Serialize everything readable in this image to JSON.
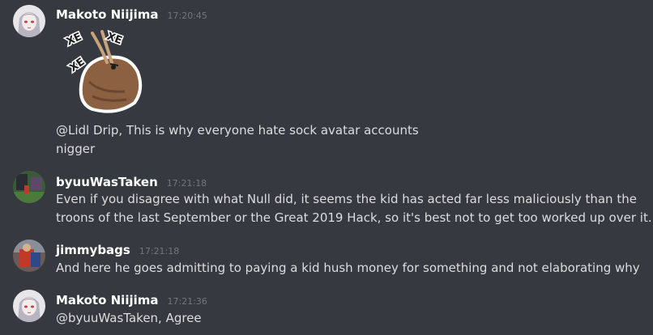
{
  "messages": [
    {
      "username": "Makoto Niijima",
      "timestamp": "17:20:45",
      "sticker": {
        "text_1": "XE",
        "text_2": "XE",
        "text_3": "XE"
      },
      "lines": [
        "@Lidl Drip, This is why everyone hate sock avatar accounts",
        "nigger"
      ]
    },
    {
      "username": "byuuWasTaken",
      "timestamp": "17:21:18",
      "lines": [
        "Even if you disagree with what Null did, it seems the kid has acted far less maliciously than the",
        "troons of the last September or the Great 2019 Hack, so it's best not to get too worked up over it."
      ]
    },
    {
      "username": "jimmybags",
      "timestamp": "17:21:18",
      "lines": [
        "And here he goes admitting to paying a kid hush money for something and not elaborating why"
      ]
    },
    {
      "username": "Makoto Niijima",
      "timestamp": "17:21:36",
      "lines": [
        "@byuuWasTaken, Agree"
      ]
    }
  ]
}
